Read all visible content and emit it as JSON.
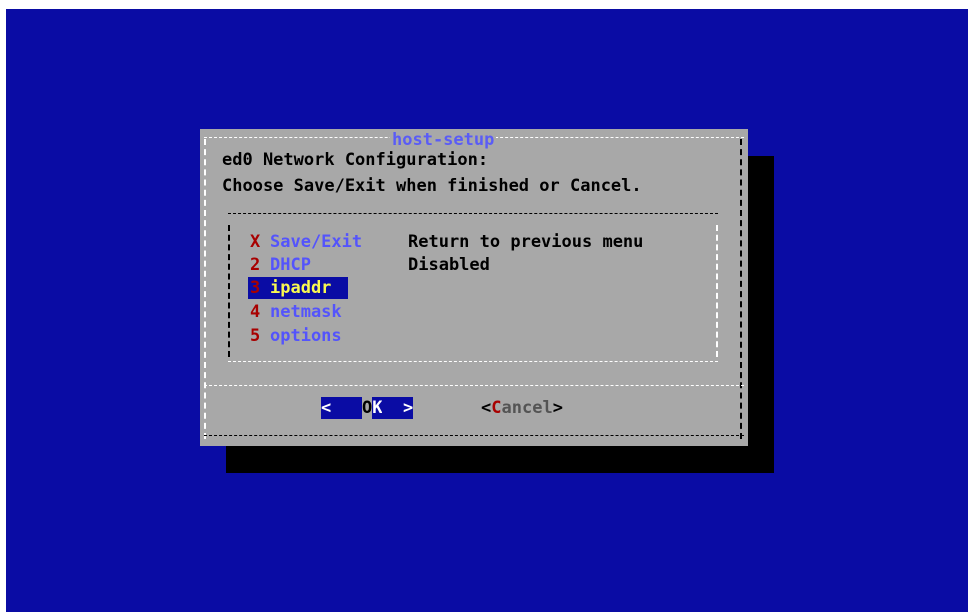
{
  "dialog": {
    "title": "host-setup",
    "line1": "ed0 Network Configuration:",
    "line2": "Choose Save/Exit when finished or Cancel."
  },
  "menu": [
    {
      "key": "X",
      "tag": "Save/Exit",
      "desc": "Return to previous menu"
    },
    {
      "key": "2",
      "tag": "DHCP",
      "desc": "Disabled"
    },
    {
      "key": "3",
      "tag": "ipaddr",
      "desc": ""
    },
    {
      "key": "4",
      "tag": "netmask",
      "desc": ""
    },
    {
      "key": "5",
      "tag": "options",
      "desc": ""
    }
  ],
  "buttons": {
    "ok_left": "<",
    "ok_pre": "O",
    "ok_key": "K",
    "ok_right": ">",
    "cancel_open": "<",
    "cancel_key": "C",
    "cancel_rest": "ancel",
    "cancel_close": ">"
  },
  "selected_item": "ipaddr",
  "colors": {
    "background": "#0a0ca4",
    "dialog": "#a8a8a8",
    "title": "#5a5cf6",
    "hotkey": "#a80000",
    "selected_text": "#f8f850"
  }
}
